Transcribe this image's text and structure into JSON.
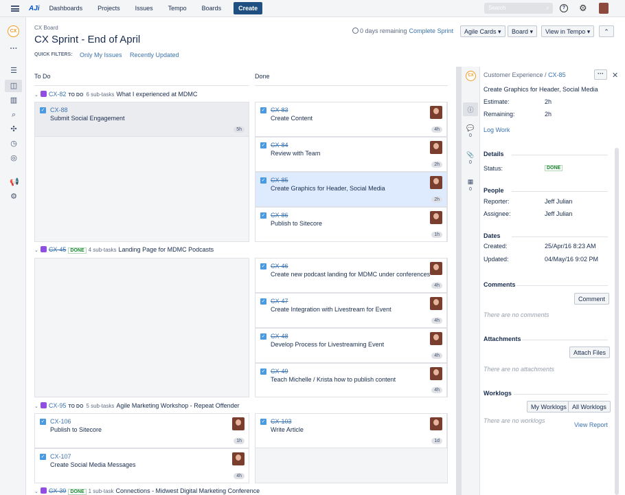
{
  "topbar": {
    "logo": "AJi",
    "nav": [
      "Dashboards",
      "Projects",
      "Issues",
      "Tempo",
      "Boards"
    ],
    "create": "Create",
    "search_placeholder": "Search"
  },
  "header": {
    "breadcrumb": "CX Board",
    "title": "CX Sprint - End of April",
    "remaining": "0 days remaining",
    "complete": "Complete Sprint",
    "quick_filters_label": "QUICK FILTERS:",
    "filters": [
      "Only My Issues",
      "Recently Updated"
    ],
    "buttons": [
      "Agile Cards",
      "Board",
      "View in Tempo"
    ]
  },
  "project_logo": "CX",
  "columns": [
    "To Do",
    "Done"
  ],
  "swimlanes": [
    {
      "key": "CX-82",
      "status": "TO DO",
      "subtasks": "6 sub-tasks",
      "title": "What I experienced at MDMC"
    },
    {
      "key": "CX-45",
      "status": "DONE",
      "subtasks": "4 sub-tasks",
      "title": "Landing Page for MDMC Podcasts"
    },
    {
      "key": "CX-95",
      "status": "TO DO",
      "subtasks": "5 sub-tasks",
      "title": "Agile Marketing Workshop - Repeat Offender"
    },
    {
      "key": "CX-39",
      "status": "DONE",
      "subtasks": "1 sub-task",
      "title": "Connections - Midwest Digital Marketing Conference"
    }
  ],
  "cards": [
    {
      "key": "CX-88",
      "summary": "Submit Social Engagement",
      "est": "5h"
    },
    {
      "key": "CX-83",
      "summary": "Create Content",
      "est": "4h"
    },
    {
      "key": "CX-84",
      "summary": "Review with Team",
      "est": "2h"
    },
    {
      "key": "CX-85",
      "summary": "Create Graphics for Header, Social Media",
      "est": "2h"
    },
    {
      "key": "CX-86",
      "summary": "Publish to Sitecore",
      "est": "1h"
    },
    {
      "key": "CX-46",
      "summary": "Create new podcast landing for MDMC under conferences",
      "est": "4h"
    },
    {
      "key": "CX-47",
      "summary": "Create Integration with Livestream for Event",
      "est": "4h"
    },
    {
      "key": "CX-48",
      "summary": "Develop Process for Livestreaming Event",
      "est": "4h"
    },
    {
      "key": "CX-49",
      "summary": "Teach Michelle / Krista how to publish content",
      "est": "4h"
    },
    {
      "key": "CX-106",
      "summary": "Publish to Sitecore",
      "est": "1h"
    },
    {
      "key": "CX-107",
      "summary": "Create Social Media Messages",
      "est": "4h"
    },
    {
      "key": "CX-103",
      "summary": "Write Article",
      "est": "1d"
    }
  ],
  "panel": {
    "project": "Customer Experience /",
    "key": "CX-85",
    "summary": "Create Graphics for Header, Social Media",
    "estimate_label": "Estimate:",
    "estimate": "2h",
    "remaining_label": "Remaining:",
    "remaining": "2h",
    "log_work": "Log Work",
    "details": "Details",
    "status_label": "Status:",
    "status": "DONE",
    "people": "People",
    "reporter_label": "Reporter:",
    "reporter": "Jeff Julian",
    "assignee_label": "Assignee:",
    "assignee": "Jeff Julian",
    "dates": "Dates",
    "created_label": "Created:",
    "created": "25/Apr/16 8:23 AM",
    "updated_label": "Updated:",
    "updated": "04/May/16 9:02 PM",
    "comments": "Comments",
    "comment_btn": "Comment",
    "no_comments": "There are no comments",
    "attachments": "Attachments",
    "attach_btn": "Attach Files",
    "no_attachments": "There are no attachments",
    "worklogs": "Worklogs",
    "my_worklogs": "My Worklogs",
    "all_worklogs": "All Worklogs",
    "no_worklogs": "There are no worklogs",
    "view_report": "View Report",
    "counts": [
      "0",
      "0",
      "0"
    ]
  }
}
